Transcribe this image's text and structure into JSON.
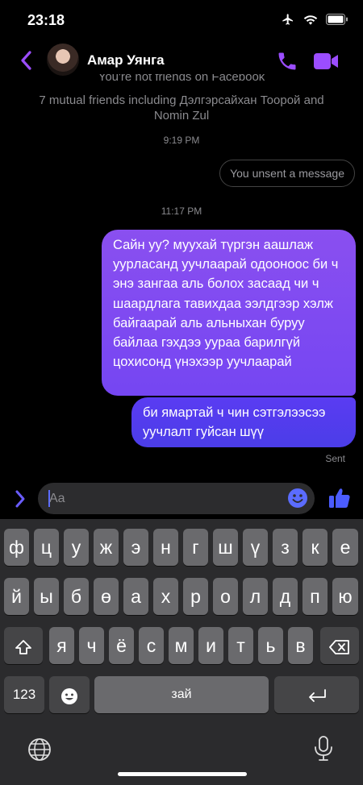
{
  "status_bar": {
    "time": "23:18"
  },
  "header": {
    "contact_name": "Амар Уянга"
  },
  "chat": {
    "not_friends_notice": "You're not friends on Facebook",
    "mutual_friends": "7 mutual friends including Дэлгэрсайхан Тоорой and Nomin Zul",
    "timestamp_1": "9:19 PM",
    "unsent_notice": "You unsent a message",
    "timestamp_2": "11:17 PM",
    "messages": [
      {
        "text": "Сайн уу? муухай түргэн аашлаж ууpласанд уучлаарай одоонoос би ч энэ зангаа аль болох засаад чи ч шаардлага тавихдаа ээлдгээр хэлж байгаарай аль альныхан буруу байлаа гэхдээ ууpаа барилгүй цохисонд үнэхээр уучлаарай"
      },
      {
        "text": "би ямартай ч чин сэтгэлээсээ уучлалт гуйсан шүү"
      }
    ],
    "sent_status": "Sent"
  },
  "composer": {
    "placeholder": "Aa"
  },
  "keyboard": {
    "row1": [
      "ф",
      "ц",
      "у",
      "ж",
      "э",
      "н",
      "г",
      "ш",
      "ү",
      "з",
      "к",
      "е"
    ],
    "row2": [
      "й",
      "ы",
      "б",
      "ө",
      "а",
      "х",
      "р",
      "о",
      "л",
      "д",
      "п",
      "ю"
    ],
    "row3": [
      "я",
      "ч",
      "ё",
      "с",
      "м",
      "и",
      "т",
      "ь",
      "в"
    ],
    "numbers_label": "123",
    "space_label": "зай"
  },
  "colors": {
    "accent": "#9b4dff",
    "bubble_purple": "#7f4cf1",
    "bubble_blue": "#4b3de8",
    "keyboard_bg": "#2b2b2d"
  }
}
